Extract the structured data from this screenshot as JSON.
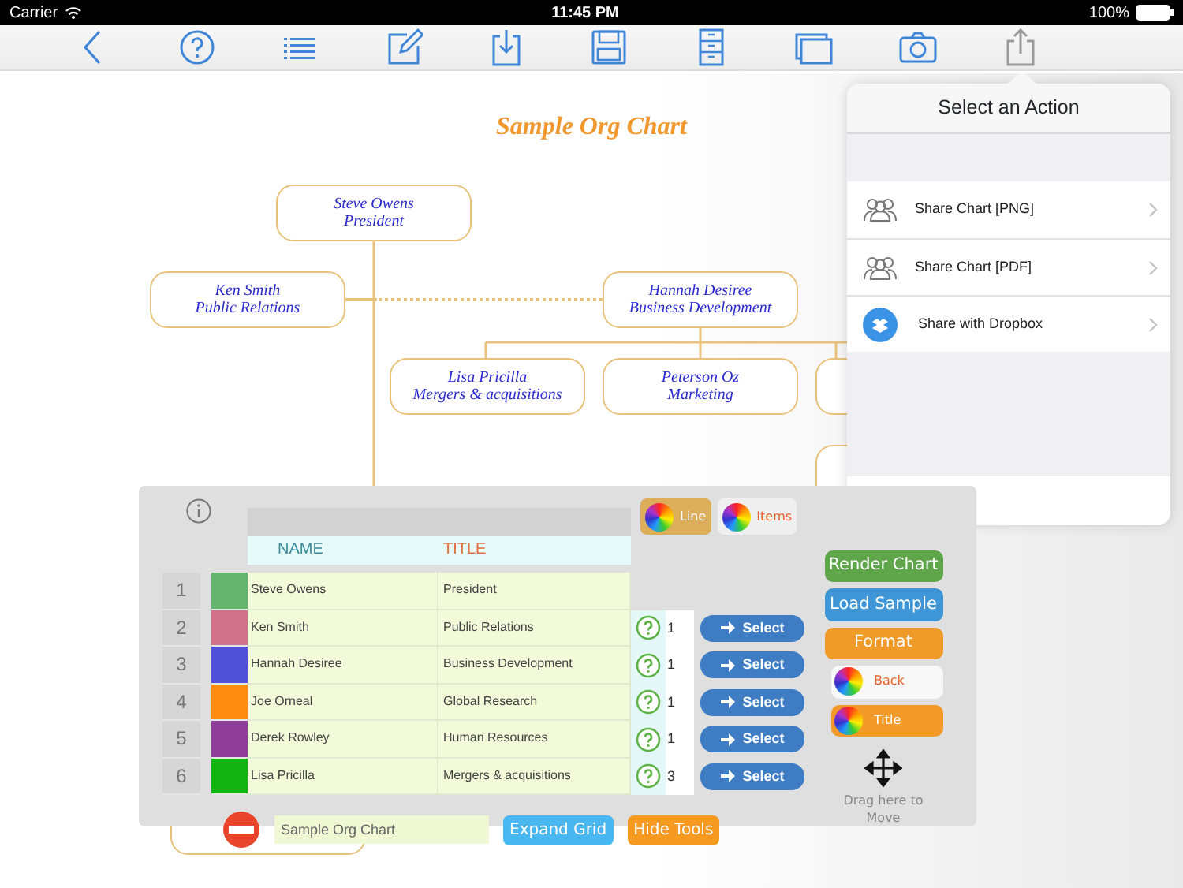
{
  "status_bar": {
    "carrier": "Carrier",
    "time": "11:45 PM",
    "battery": "100%"
  },
  "toolbar": [
    {
      "kind": "back",
      "selected": false
    },
    {
      "kind": "help",
      "selected": false
    },
    {
      "kind": "list",
      "selected": false
    },
    {
      "kind": "edit",
      "selected": false
    },
    {
      "kind": "import",
      "selected": false
    },
    {
      "kind": "save",
      "selected": false
    },
    {
      "kind": "cabinet",
      "selected": false
    },
    {
      "kind": "windows",
      "selected": false
    },
    {
      "kind": "camera",
      "selected": false
    },
    {
      "kind": "share",
      "selected": true
    }
  ],
  "chart": {
    "title": "Sample Org Chart",
    "root": {
      "name": "Steve Owens",
      "title": "President",
      "children": [
        {
          "name": "Ken Smith",
          "title": "Public Relations",
          "dotted_link": false
        },
        {
          "name": "Hannah Desiree",
          "title": "Business Development",
          "dotted_link": true,
          "children": [
            {
              "name": "Lisa Pricilla",
              "title": "Mergers & acquisitions"
            },
            {
              "name": "Peterson Oz",
              "title": "Marketing"
            }
          ]
        }
      ]
    }
  },
  "popover": {
    "title": "Select an Action",
    "actions": [
      {
        "label": "Share Chart [PNG]",
        "kind": "people"
      },
      {
        "label": "Share Chart [PDF]",
        "kind": "people"
      },
      {
        "label": "Share with Dropbox",
        "kind": "dropbox"
      }
    ]
  },
  "tools": {
    "palette_buttons": [
      {
        "label": "Line",
        "color": "#dcae5a"
      },
      {
        "label": "Items",
        "color": "#efefef"
      }
    ],
    "columns": [
      {
        "label": "NAME",
        "color": "#3a8a9a"
      },
      {
        "label": "TITLE",
        "color": "#e0703a"
      }
    ],
    "rows": [
      {
        "number": "1",
        "color": "#64b36e",
        "name": "Steve Owens",
        "title": "President"
      },
      {
        "number": "2",
        "color": "#d0708a",
        "name": "Ken Smith",
        "title": "Public Relations",
        "count": "1",
        "action": "Select"
      },
      {
        "number": "3",
        "color": "#5050d8",
        "name": "Hannah Desiree",
        "title": "Business Development",
        "count": "1",
        "action": "Select"
      },
      {
        "number": "4",
        "color": "#ff8c10",
        "name": "Joe Orneal",
        "title": "Global Research",
        "count": "1",
        "action": "Select"
      },
      {
        "number": "5",
        "color": "#8e3e98",
        "name": "Derek Rowley",
        "title": "Human Resources",
        "count": "1",
        "action": "Select"
      },
      {
        "number": "6",
        "color": "#12b412",
        "name": "Lisa Pricilla",
        "title": "Mergers & acquisitions",
        "count": "3",
        "action": "Select"
      }
    ],
    "actions": [
      {
        "label": "Render Chart",
        "kind": "plain",
        "color": "#5fa64a"
      },
      {
        "label": "Load Sample",
        "kind": "plain",
        "color": "#3f96d6"
      },
      {
        "label": "Format",
        "kind": "plain",
        "color": "#f09a2a"
      },
      {
        "label": "Back",
        "kind": "wheel",
        "color": "#f8f8f8"
      },
      {
        "label": "Title",
        "kind": "wheel",
        "color": "#f39a2a"
      }
    ],
    "drag_hint": "Drag here to Move",
    "title_field": {
      "value": "Sample Org Chart"
    },
    "bottom_buttons": [
      {
        "label": "Expand Grid",
        "color": "#4ab8f0"
      },
      {
        "label": "Hide Tools",
        "color": "#f79a22"
      }
    ]
  }
}
